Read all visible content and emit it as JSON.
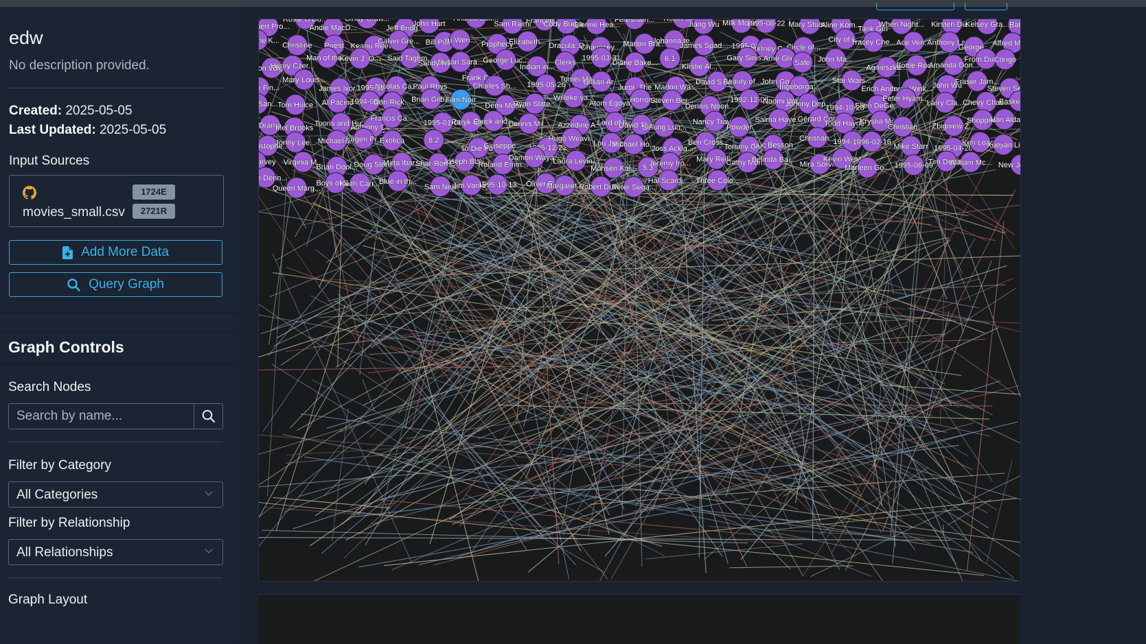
{
  "project": {
    "name": "edw",
    "description": "No description provided.",
    "created_label": "Created:",
    "created": "2025-05-05",
    "updated_label": "Last Updated:",
    "updated": "2025-05-05"
  },
  "input_sources": {
    "title": "Input Sources",
    "sources": [
      {
        "name": "movies_small.csv",
        "icon": "github-icon",
        "edges_badge": "1724E",
        "rows_badge": "2721R"
      }
    ]
  },
  "actions": {
    "add_data": "Add More Data",
    "query_graph": "Query Graph"
  },
  "graph_controls": {
    "title": "Graph Controls",
    "search_label": "Search Nodes",
    "search_placeholder": "Search by name...",
    "category_label": "Filter by Category",
    "category_value": "All Categories",
    "relationship_label": "Filter by Relationship",
    "relationship_value": "All Relationships",
    "layout_label": "Graph Layout"
  },
  "graph": {
    "node_color": "#9b59d6",
    "selected_node_color": "#3b9be8",
    "edge_colors": [
      "#7f9aa8",
      "#9ab3b0",
      "#b06a5e",
      "#c7c59a",
      "#7fa0c0"
    ],
    "node_labels": [
      "Robert Pro...",
      "Rosie O'Do...",
      "Andie MacD...",
      "Cindy Craw...",
      "Jeff Bridg...",
      "John Hurt",
      "Andrea Eck...",
      "Sam Raimi",
      "François ...",
      "Cody Burge...",
      "Glenne Hea...",
      "Fereshteh...",
      "Robin Shou",
      "Jiang Wu",
      "Milk Money",
      "1995-08-22",
      "Mary Stuar...",
      "Aline Kom...",
      "Tank Girl",
      "When Night...",
      "Kirsten Du...",
      "Kelsey Gra...",
      "Babe",
      "Madeline K...",
      "Christine",
      "Priest",
      "Keanu Reev...",
      "Calvin Gre...",
      "Bill Pullm...",
      "Yu-Wen...",
      "Prophecy",
      "Elizabeth...",
      "Dracula: D...",
      "Chauncey...",
      "Marlon Bra...",
      "Johanna te...",
      "James Spad...",
      "1995-08-11",
      "Courtney C...",
      "Circle of...",
      "City of L...",
      "Tracey Che...",
      "Ace Ven...",
      "Anthony La...",
      "George...",
      "Alfred Mol...",
      "Jon Voight",
      "Henry Czer...",
      "Man of the...",
      "Kevin J. O...",
      "Said Taghm...",
      "Sandy Neis...",
      "Susan Sara...",
      "George Luc...",
      "Indian in...",
      "Clerks",
      "1995-03-31",
      "Diane Bake...",
      "6.1",
      "Kirstie Al...",
      "Gary Sinis...",
      "Arne Glimc...",
      "Safe",
      "John Ma...",
      "Agnieszka...",
      "Bottle Roc...",
      "Amanda Don...",
      "From Dusk...",
      "Congo",
      "Carole Fin...",
      "Mary-Louis...",
      "James Ivor...",
      "1995-11-03",
      "Nicolas Ca...",
      "Paul Rhys",
      "Frank Oz",
      "Charles Sh...",
      "1995-05-26",
      "Tomei Mitc...",
      "Gillian Ar...",
      "Juror, The",
      "Marlon Wa...",
      "David S. W...",
      "Beauty of...",
      "John Goodm...",
      "Ingeborga...",
      "Star Wars...",
      "Erich Ande...",
      "Irwin Wink...",
      "John Wu",
      "Fraser Jam...",
      "Steven Sea...",
      "Laura San...",
      "Tom Hulce",
      "Al Pacino",
      "1994-08-03",
      "Don Rick...",
      "Brian Gilb...",
      "Film-Noir",
      "Demi Moore",
      "Ryan Slate...",
      "Willeke va...",
      "Atom Egoya...",
      "Horror",
      "Steven Ber...",
      "Dennis Noon...",
      "1992-12-06",
      "Naomi Wat...",
      "Johnny Dep...",
      "1994-10-28",
      "Ellen DeGe...",
      "Peter Hyam...",
      "Larry Cla...",
      "Chevy Chas...",
      "Basketball...",
      "Drama",
      "Mel Brooks",
      "Toons and Hu...",
      "Anthony Cu...",
      "Francis Ca...",
      "1995-01-06",
      "Raryk Egan",
      "Quick and...",
      "Dennis Mil...",
      "Azzedine A...",
      "Lord of Il...",
      "David Thew...",
      "Sihung Lun...",
      "Nancy Trav...",
      "Powder",
      "Salma Haye...",
      "Gérard Cor...",
      "Todd Hayne",
      "Krystia Mo...",
      "Christian",
      "Zbigniew Z...",
      "Shopping",
      "Alan Alda",
      "Christophe...",
      "Jonny Lee...",
      "Michael J...",
      "Jürgen Pr...",
      "Exotica",
      "8.2",
      "To Die For",
      "Giuseppe...",
      "1995-12-22",
      "Hugo Weavi...",
      "Lou Jacobi",
      "Michael Ho...",
      "Joss Ackla...",
      "Ben Cross",
      "Tommy Chon...",
      "Luc Besson",
      "Christian...",
      "1994-10-14",
      "1996-02-16",
      "Mike Starr",
      "1995-04-28",
      "Ken Loach",
      "Xuejian Li",
      "Don Harvey",
      "Virginia M...",
      "Brian Dool...",
      "Doug Stone",
      "Mirta Ibar...",
      "Shar-Ron C...",
      "Joseph Bla...",
      "Roland Emm...",
      "Damon Waya...",
      "Laura Levin...",
      "Mohsen Kal...",
      "5.3",
      "Jeremy Iro...",
      "Mary Reill...",
      "Cathy Mori...",
      "Belinda Ba...",
      "Mira Sorvi...",
      "Kevin West",
      "Marleen Go...",
      "1995-06-09",
      "Tim Dutton",
      "William Mc...",
      "New Jersey...",
      "Brian Denn...",
      "Queen Marg...",
      "Boys of S...",
      "Keith Carr...",
      "Blue in th...",
      "Sam Neill",
      "Jim Varney",
      "1995-10-13",
      "Oliver Par...",
      "Margaret...",
      "Robert Duv...",
      "Peter Sega...",
      "Hal Scardi...",
      "Three Colo..."
    ]
  }
}
